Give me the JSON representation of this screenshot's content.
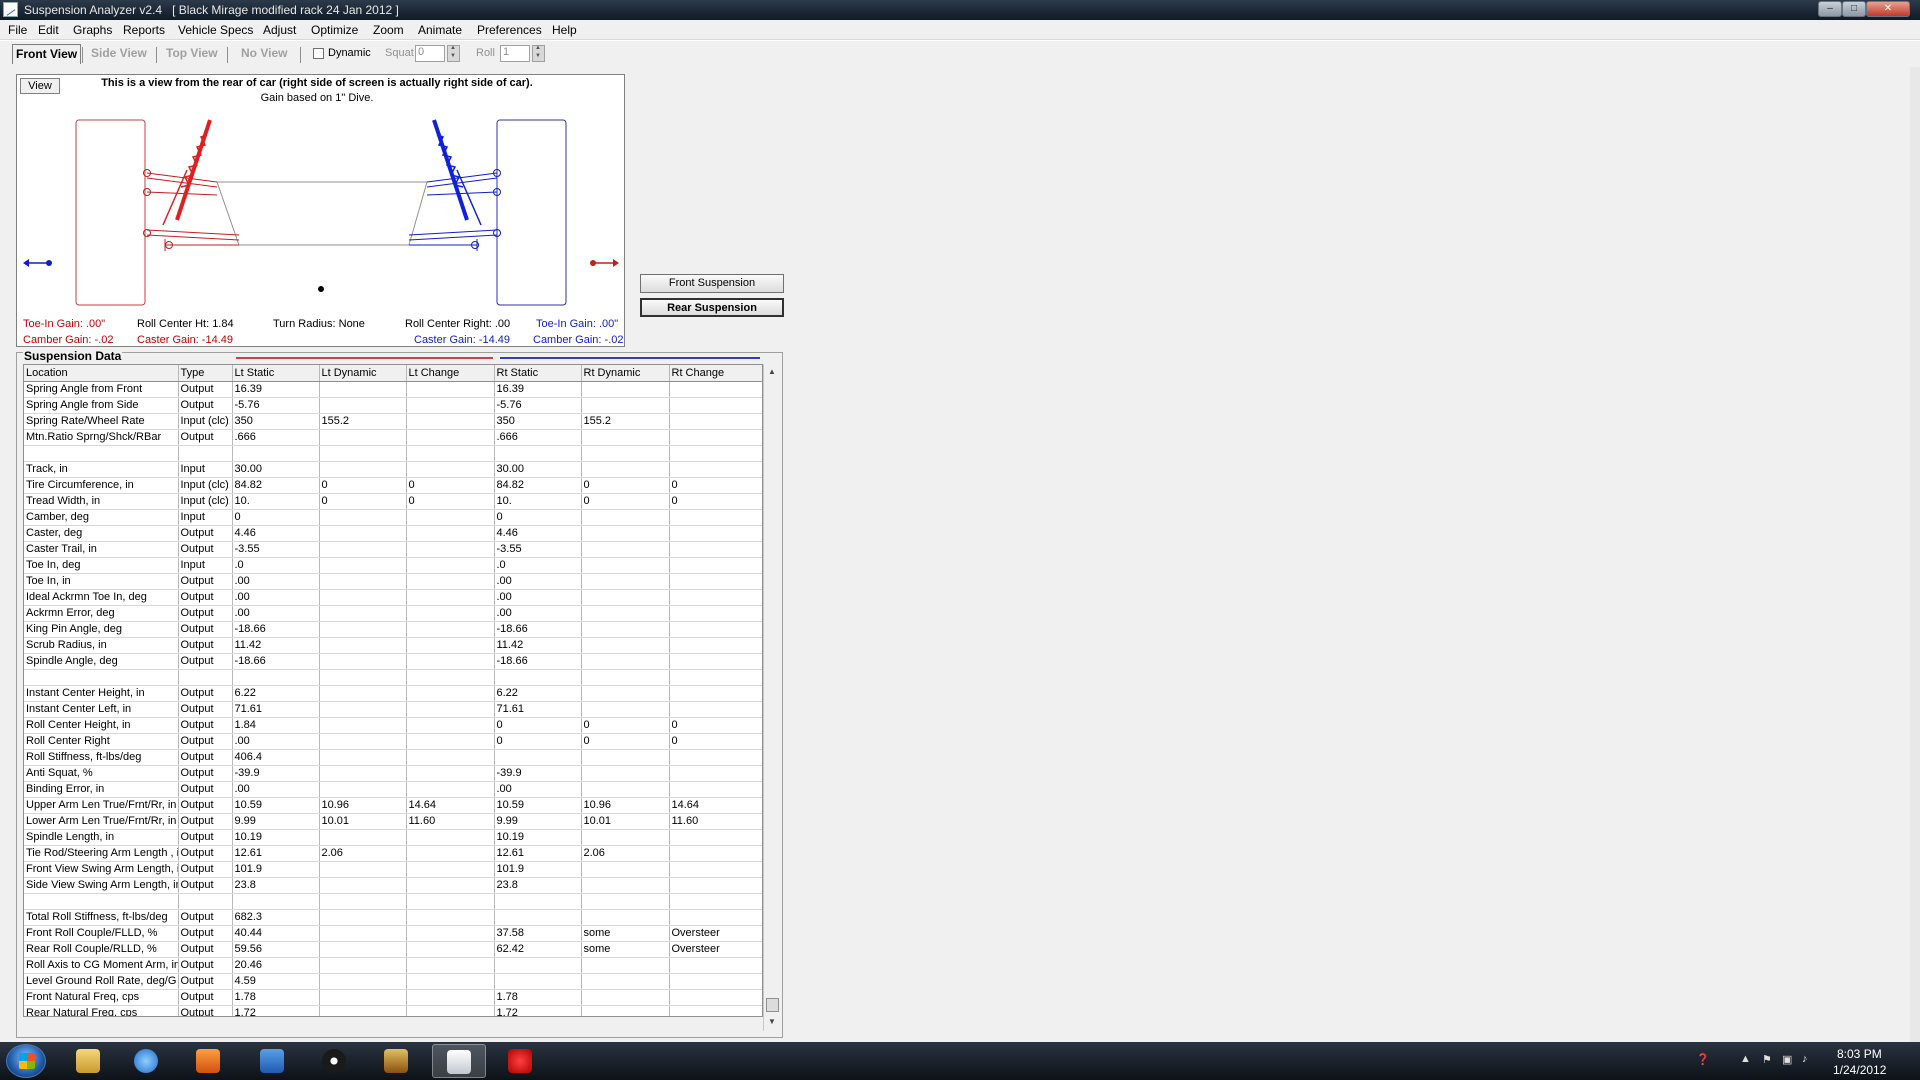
{
  "window": {
    "title": "Suspension Analyzer v2.4   [ Black Mirage modified rack 24 Jan 2012 ]",
    "min": "–",
    "max": "□",
    "close": "✕"
  },
  "menu": [
    "File",
    "Edit",
    "Graphs",
    "Reports",
    "Vehicle Specs",
    "Adjust",
    "Optimize",
    "Zoom",
    "Animate",
    "Preferences",
    "Help"
  ],
  "toolbar": {
    "tabs": [
      "Front View",
      "Side View",
      "Top View",
      "No View"
    ],
    "dynamic_label": "Dynamic",
    "dynamic_checked": false,
    "squat_label": "Squat",
    "squat_value": "0",
    "roll_label": "Roll",
    "roll_value": "1"
  },
  "diagram": {
    "view_button": "View",
    "title": "This is a view from the rear of car (right side of screen is actually right side of car).",
    "subtitle": "Gain based on 1\" Dive.",
    "labels": {
      "toe_in_gain_left": "Toe-In Gain: .00\"",
      "camber_gain_left": "Camber Gain: -.02",
      "roll_center_ht": "Roll Center Ht: 1.84",
      "caster_gain_left": "Caster Gain: -14.49",
      "turn_radius": "Turn Radius: None",
      "roll_center_right": "Roll Center Right: .00",
      "caster_gain_right": "Caster Gain: -14.49",
      "toe_in_gain_right": "Toe-In Gain: .00\"",
      "camber_gain_right": "Camber Gain: -.02"
    },
    "colors": {
      "left": "#e02020",
      "right": "#1020e0",
      "tire_left": "#c04040",
      "tire_right": "#3030a0"
    }
  },
  "buttons": {
    "front_suspension": "Front Suspension",
    "rear_suspension": "Rear Suspension"
  },
  "suspension_data": {
    "group_label": "Suspension Data",
    "columns": [
      "Location",
      "Type",
      "Lt Static",
      "Lt Dynamic",
      "Lt Change",
      "Rt Static",
      "Rt Dynamic",
      "Rt Change"
    ],
    "rows": [
      [
        "Spring Angle from Front",
        "Output",
        "16.39",
        "",
        "",
        "16.39",
        "",
        ""
      ],
      [
        "Spring Angle from Side",
        "Output",
        "-5.76",
        "",
        "",
        "-5.76",
        "",
        ""
      ],
      [
        "Spring Rate/Wheel Rate",
        "Input (clc)",
        "350",
        "155.2",
        "",
        "350",
        "155.2",
        ""
      ],
      [
        "Mtn.Ratio Sprng/Shck/RBar",
        "Output",
        ".666",
        "",
        "",
        ".666",
        "",
        ""
      ],
      [
        "",
        "",
        "",
        "",
        "",
        "",
        "",
        ""
      ],
      [
        "Track, in",
        "Input",
        "30.00",
        "",
        "",
        "30.00",
        "",
        ""
      ],
      [
        "Tire Circumference, in",
        "Input (clc)",
        "84.82",
        "0",
        "0",
        "84.82",
        "0",
        "0"
      ],
      [
        "Tread Width, in",
        "Input (clc)",
        "10.",
        "0",
        "0",
        "10.",
        "0",
        "0"
      ],
      [
        "Camber, deg",
        "Input",
        "0",
        "",
        "",
        "0",
        "",
        ""
      ],
      [
        "Caster, deg",
        "Output",
        "4.46",
        "",
        "",
        "4.46",
        "",
        ""
      ],
      [
        "Caster Trail, in",
        "Output",
        "-3.55",
        "",
        "",
        "-3.55",
        "",
        ""
      ],
      [
        "Toe In, deg",
        "Input",
        ".0",
        "",
        "",
        ".0",
        "",
        ""
      ],
      [
        "Toe In, in",
        "Output",
        ".00",
        "",
        "",
        ".00",
        "",
        ""
      ],
      [
        "Ideal Ackrmn Toe In, deg",
        "Output",
        ".00",
        "",
        "",
        ".00",
        "",
        ""
      ],
      [
        "Ackrmn Error, deg",
        "Output",
        ".00",
        "",
        "",
        ".00",
        "",
        ""
      ],
      [
        "King Pin Angle, deg",
        "Output",
        "-18.66",
        "",
        "",
        "-18.66",
        "",
        ""
      ],
      [
        "Scrub Radius, in",
        "Output",
        "11.42",
        "",
        "",
        "11.42",
        "",
        ""
      ],
      [
        "Spindle Angle, deg",
        "Output",
        "-18.66",
        "",
        "",
        "-18.66",
        "",
        ""
      ],
      [
        "",
        "",
        "",
        "",
        "",
        "",
        "",
        ""
      ],
      [
        "Instant Center Height, in",
        "Output",
        "6.22",
        "",
        "",
        "6.22",
        "",
        ""
      ],
      [
        "Instant Center Left, in",
        "Output",
        "71.61",
        "",
        "",
        "71.61",
        "",
        ""
      ],
      [
        "Roll Center Height, in",
        "Output",
        "1.84",
        "",
        "",
        "0",
        "0",
        "0"
      ],
      [
        "Roll Center Right",
        "Output",
        ".00",
        "",
        "",
        "0",
        "0",
        "0"
      ],
      [
        "Roll Stiffness, ft-lbs/deg",
        "Output",
        "406.4",
        "",
        "",
        "",
        "",
        ""
      ],
      [
        "Anti Squat, %",
        "Output",
        "-39.9",
        "",
        "",
        "-39.9",
        "",
        ""
      ],
      [
        "Binding Error, in",
        "Output",
        ".00",
        "",
        "",
        ".00",
        "",
        ""
      ],
      [
        "Upper Arm Len True/Frnt/Rr, in",
        "Output",
        "10.59",
        "10.96",
        "14.64",
        "10.59",
        "10.96",
        "14.64"
      ],
      [
        "Lower Arm Len True/Frnt/Rr, in",
        "Output",
        "9.99",
        "10.01",
        "11.60",
        "9.99",
        "10.01",
        "11.60"
      ],
      [
        "Spindle Length, in",
        "Output",
        "10.19",
        "",
        "",
        "10.19",
        "",
        ""
      ],
      [
        "Tie Rod/Steering Arm Length , in",
        "Output",
        "12.61",
        "2.06",
        "",
        "12.61",
        "2.06",
        ""
      ],
      [
        "Front View Swing Arm Length, in",
        "Output",
        "101.9",
        "",
        "",
        "101.9",
        "",
        ""
      ],
      [
        "Side View Swing Arm Length, in",
        "Output",
        "23.8",
        "",
        "",
        "23.8",
        "",
        ""
      ],
      [
        "",
        "",
        "",
        "",
        "",
        "",
        "",
        ""
      ],
      [
        "Total Roll Stiffness, ft-lbs/deg",
        "Output",
        "682.3",
        "",
        "",
        "",
        "",
        ""
      ],
      [
        "Front Roll Couple/FLLD, %",
        "Output",
        "40.44",
        "",
        "",
        "37.58",
        "some",
        "Oversteer"
      ],
      [
        "Rear Roll Couple/RLLD, %",
        "Output",
        "59.56",
        "",
        "",
        "62.42",
        "some",
        "Oversteer"
      ],
      [
        "Roll Axis to CG Moment Arm, in",
        "Output",
        "20.46",
        "",
        "",
        "",
        "",
        ""
      ],
      [
        "Level Ground Roll Rate, deg/G",
        "Output",
        "4.59",
        "",
        "",
        "",
        "",
        ""
      ],
      [
        "Front Natural Freq, cps",
        "Output",
        "1.78",
        "",
        "",
        "1.78",
        "",
        ""
      ],
      [
        "Rear Natural Freq, cps",
        "Output",
        "1.72",
        "",
        "",
        "1.72",
        "",
        ""
      ]
    ]
  },
  "taskbar": {
    "time": "8:03 PM",
    "date": "1/24/2012",
    "icons": [
      "explorer-icon",
      "ie-icon",
      "media-player-icon",
      "tasks-icon",
      "hp-icon",
      "app-icon",
      "suspension-analyzer-icon",
      "paint-icon"
    ]
  }
}
